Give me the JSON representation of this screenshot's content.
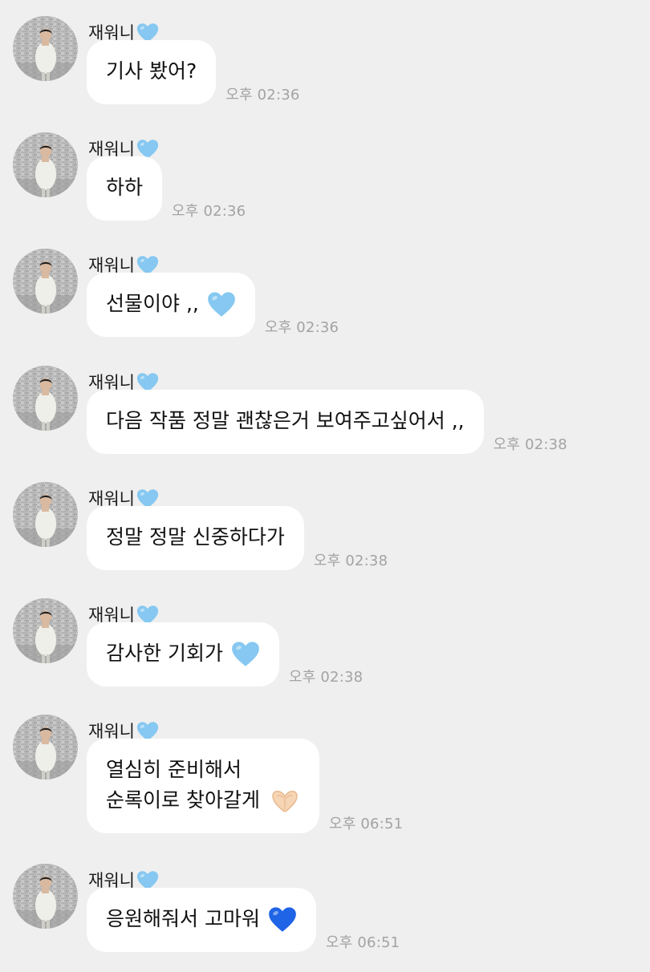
{
  "sender": {
    "name": "재워니"
  },
  "colors": {
    "background": "#efefef",
    "bubble": "#ffffff",
    "time": "#a3a3a3",
    "light_blue_heart": "#86c8f1",
    "blue_heart": "#1f64e6"
  },
  "messages": [
    {
      "lines": [
        "기사 봤어?"
      ],
      "time": "오후 02:36"
    },
    {
      "lines": [
        "하하"
      ],
      "time": "오후 02:36"
    },
    {
      "lines": [
        "선물이야 ,,"
      ],
      "emoji": "light-blue-heart-icon",
      "time": "오후 02:36"
    },
    {
      "lines": [
        "다음 작품 정말 괜찮은거 보여주고싶어서 ,,"
      ],
      "time": "오후 02:38"
    },
    {
      "lines": [
        "정말 정말 신중하다가"
      ],
      "time": "오후 02:38"
    },
    {
      "lines": [
        "감사한 기회가"
      ],
      "emoji": "light-blue-heart-icon",
      "time": "오후 02:38"
    },
    {
      "lines": [
        "열심히 준비해서",
        "순록이로 찾아갈게"
      ],
      "emoji": "heart-hands-icon",
      "time": "오후 06:51"
    },
    {
      "lines": [
        "응원해줘서 고마워"
      ],
      "emoji": "blue-heart-icon",
      "time": "오후 06:51"
    }
  ]
}
